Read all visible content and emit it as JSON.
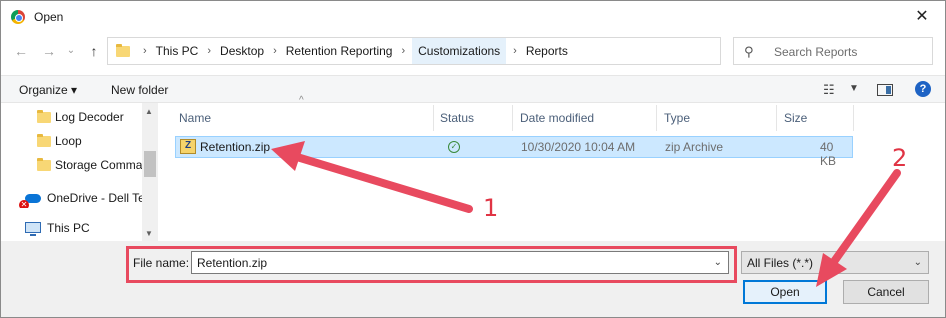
{
  "window": {
    "title": "Open",
    "close_glyph": "✕"
  },
  "navigation": {
    "back_glyph": "←",
    "forward_glyph": "→",
    "dropdown_glyph": "⌄",
    "up_glyph": "↑"
  },
  "address_bar": {
    "breadcrumbs": [
      "This PC",
      "Desktop",
      "Retention Reporting",
      "Customizations",
      "Reports"
    ],
    "separator": "›",
    "dropdown_glyph": "⌄",
    "refresh_glyph": "↻"
  },
  "search": {
    "placeholder": "Search Reports",
    "icon_glyph": "⚲"
  },
  "toolbar": {
    "organize_label": "Organize ▾",
    "new_folder_label": "New folder",
    "view_glyph": "☷",
    "view_dropdown_glyph": "▼",
    "help_glyph": "?"
  },
  "sidebar": {
    "items": [
      {
        "label": "Log Decoder",
        "icon": "folder-icon"
      },
      {
        "label": "Loop",
        "icon": "folder-icon"
      },
      {
        "label": "Storage Comma",
        "icon": "folder-icon"
      },
      {
        "label": "OneDrive - Dell Te",
        "icon": "onedrive-icon"
      },
      {
        "label": "This PC",
        "icon": "computer-icon"
      }
    ],
    "scroll_up_glyph": "▲",
    "scroll_down_glyph": "▼",
    "onedrive_error_glyph": "✕"
  },
  "file_list": {
    "columns": [
      "Name",
      "Status",
      "Date modified",
      "Type",
      "Size"
    ],
    "sort_glyph": "^",
    "rows": [
      {
        "name": "Retention.zip",
        "status_glyph": "✓",
        "date_modified": "10/30/2020 10:04 AM",
        "type": "zip Archive",
        "size": "40 KB",
        "selected": true
      }
    ]
  },
  "bottom": {
    "file_name_label": "File name:",
    "file_name_value": "Retention.zip",
    "file_name_dropdown_glyph": "⌄",
    "filter_value": "All Files (*.*)",
    "filter_dropdown_glyph": "⌄",
    "open_label": "Open",
    "cancel_label": "Cancel"
  },
  "annotations": {
    "label_1": "1",
    "label_2": "2",
    "color": "#e84a5f"
  },
  "colors": {
    "selection": "#cce8ff",
    "accent": "#0078d7",
    "annotation_red": "#e84a5f"
  }
}
